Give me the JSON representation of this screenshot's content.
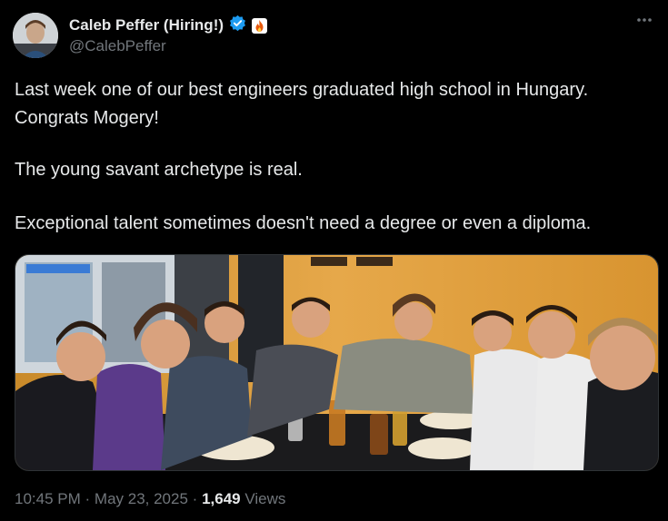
{
  "author": {
    "display_name": "Caleb Peffer (Hiring!)",
    "handle": "@CalebPeffer",
    "badge_emoji": "🔥",
    "verified_color": "#1d9bf0",
    "badge_color": "#e8590c"
  },
  "post": {
    "lines": [
      "Last week one of our best engineers graduated high school in Hungary.",
      "Congrats Mogery!",
      "The young savant archetype is real.",
      "Exceptional talent sometimes doesn't need a degree or even a diploma."
    ]
  },
  "meta": {
    "time": "10:45 PM",
    "sep1": "·",
    "date": "May 23, 2025",
    "sep2": "·",
    "views_count": "1,649",
    "views_label": "Views"
  },
  "icons": {
    "more": "more-options-icon",
    "verified": "verified-badge-icon"
  }
}
